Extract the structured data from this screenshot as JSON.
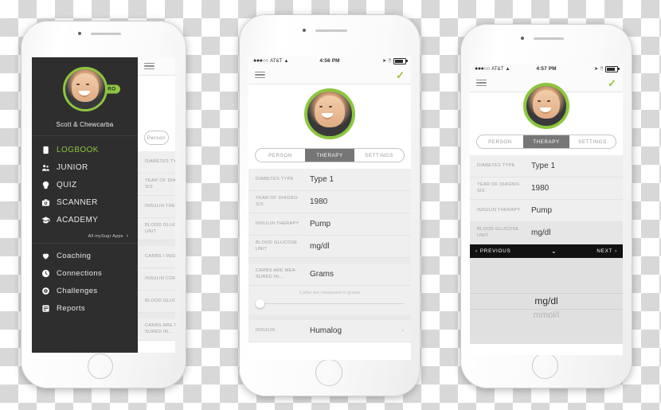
{
  "brand": {
    "green": "#8cc63f",
    "dark": "#2e2e2e",
    "pro_label": "PRO"
  },
  "phone1": {
    "drawer": {
      "user_name": "Scott & Chewcarba",
      "primary_items": [
        {
          "label": "LOGBOOK",
          "icon": "logbook-icon",
          "active": true
        },
        {
          "label": "JUNIOR",
          "icon": "junior-icon",
          "active": false
        },
        {
          "label": "QUIZ",
          "icon": "quiz-icon",
          "active": false
        },
        {
          "label": "SCANNER",
          "icon": "scanner-icon",
          "active": false
        },
        {
          "label": "ACADEMY",
          "icon": "academy-icon",
          "active": false
        }
      ],
      "apps_link": {
        "label": "All mySugr Apps",
        "chevron": "‹"
      },
      "secondary_items": [
        {
          "label": "Coaching",
          "icon": "coaching-icon"
        },
        {
          "label": "Connections",
          "icon": "connections-icon"
        },
        {
          "label": "Challenges",
          "icon": "challenges-icon"
        },
        {
          "label": "Reports",
          "icon": "reports-icon"
        }
      ]
    },
    "behind": {
      "tab_visible": "Person",
      "rows": [
        "DIABETES TYPE",
        "YEAR OF DIAGNO-SIS",
        "INSULIN THERA",
        "BLOOD GLUCO UNIT",
        "CARBS / INSULI",
        "INSULIN CORRE",
        "BLOOD GLUCO",
        "CARBS ARE ME- SURED IN..."
      ]
    }
  },
  "phone2": {
    "statusbar": {
      "dots": "●●●○○",
      "carrier": "AT&T",
      "wifi": "▲",
      "time": "4:56 PM",
      "location": "➤",
      "bluetooth": "ᛗ"
    },
    "navbar": {
      "menu": "hamburger-icon",
      "confirm": "✓"
    },
    "tabs": [
      {
        "label": "PERSON",
        "selected": false
      },
      {
        "label": "THERAPY",
        "selected": true
      },
      {
        "label": "SETTINGS",
        "selected": false
      }
    ],
    "rows": [
      {
        "key": "DIABETES TYPE",
        "value": "Type 1"
      },
      {
        "key": "YEAR OF DIAGNO-SIS",
        "value": "1980"
      },
      {
        "key": "INSULIN THERAPY",
        "value": "Pump"
      },
      {
        "key": "BLOOD GLUCOSE UNIT",
        "value": "mg/dl"
      }
    ],
    "carbs_row": {
      "key": "CARBS ARE MEA-SURED IN...",
      "value": "Grams"
    },
    "slider_hint": "Carbs are measured in grams",
    "insulin_row": {
      "key": "INSULIN",
      "value": "Humalog",
      "chevron": "›"
    }
  },
  "phone3": {
    "statusbar": {
      "dots": "●●●○○",
      "carrier": "AT&T",
      "wifi": "▲",
      "time": "4:57 PM",
      "location": "➤",
      "bluetooth": "ᛗ"
    },
    "navbar": {
      "menu": "hamburger-icon",
      "confirm": "✓"
    },
    "tabs": [
      {
        "label": "PERSON",
        "selected": false
      },
      {
        "label": "THERAPY",
        "selected": true
      },
      {
        "label": "SETTINGS",
        "selected": false
      }
    ],
    "rows": [
      {
        "key": "DIABETES TYPE",
        "value": "Type 1"
      },
      {
        "key": "YEAR OF DIAGNO-SIS",
        "value": "1980"
      },
      {
        "key": "INSULIN THERAPY",
        "value": "Pump"
      },
      {
        "key": "BLOOD GLUCOSE UNIT",
        "value": "mg/dl",
        "highlighted": true
      }
    ],
    "picker_toolbar": {
      "previous": "PREVIOUS",
      "prev_chevron": "‹",
      "collapse": "⌄",
      "next": "NEXT",
      "next_chevron": "›"
    },
    "picker_options": [
      {
        "label": "mg/dl",
        "selected": true
      },
      {
        "label": "mmol/l",
        "selected": false
      }
    ]
  }
}
